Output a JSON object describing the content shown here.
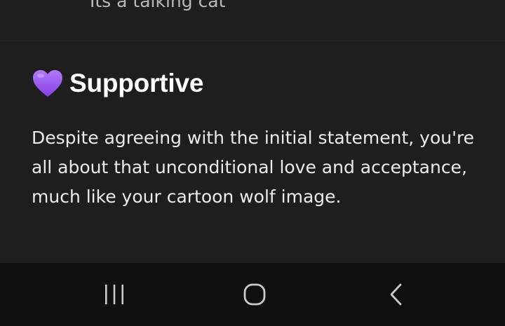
{
  "previous_item": {
    "text": "Its a talking cat"
  },
  "section": {
    "icon": "purple-heart-icon",
    "title": "Supportive",
    "description": "Despite agreeing with the initial statement, you're all about that unconditional love and acceptance, much like your cartoon wolf image."
  },
  "colors": {
    "background": "#1e1e1f",
    "navbar": "#0f0f10",
    "heart": "#9b5cf2"
  },
  "navbar": {
    "buttons": [
      "recents-icon",
      "home-icon",
      "back-icon"
    ]
  }
}
